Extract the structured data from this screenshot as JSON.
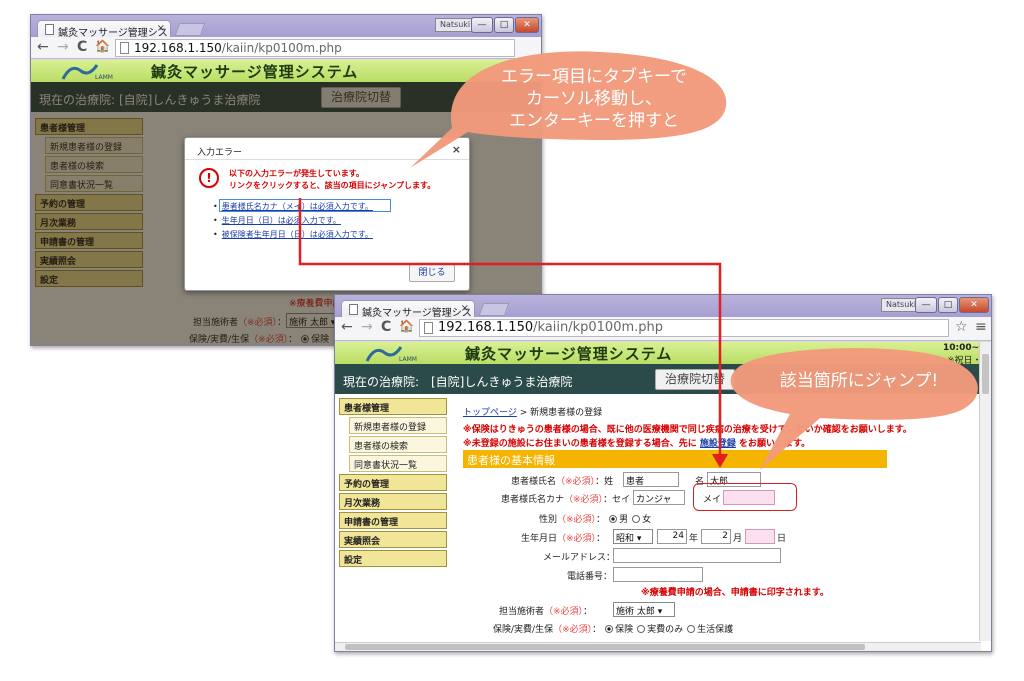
{
  "browser": {
    "tab_title": "鍼灸マッサージ管理シス",
    "tab_close": "×",
    "url_host": "192.168.1.150",
    "url_path": "/kaiin/kp0100m.php",
    "user_badge": "Natsuki",
    "btn_min": "—",
    "btn_max": "□",
    "btn_close": "✕",
    "back": "←",
    "forward": "→",
    "reload": "C",
    "home": "🏠",
    "star": "☆",
    "menu": "≡"
  },
  "app": {
    "logo_text": "LAMM",
    "title": "鍼灸マッサージ管理システム",
    "clinic_label": "現在の治療院:",
    "clinic_value": "[自院]しんきゅうま治療院",
    "switch_button": "治療院切替",
    "clock": "10:00~",
    "clock_sub": "※祝日・"
  },
  "sidebar": {
    "items": [
      {
        "label": "患者様管理",
        "sub": false
      },
      {
        "label": "新規患者様の登録",
        "sub": true
      },
      {
        "label": "患者様の検索",
        "sub": true
      },
      {
        "label": "同意書状況一覧",
        "sub": true
      },
      {
        "label": "予約の管理",
        "sub": false
      },
      {
        "label": "月次業務",
        "sub": false
      },
      {
        "label": "申請書の管理",
        "sub": false
      },
      {
        "label": "実績照会",
        "sub": false
      },
      {
        "label": "設定",
        "sub": false
      }
    ]
  },
  "modal": {
    "title": "入力エラー",
    "close": "×",
    "warn_icon": "!",
    "message1": "以下の入力エラーが発生しています。",
    "message2": "リンクをクリックすると、該当の項目にジャンプします。",
    "bullet": "•",
    "errors": [
      "患者様氏名カナ（メイ）は必須入力です。",
      "生年月日（日）は必須入力です。",
      "被保険者生年月日（日）は必須入力です。"
    ],
    "close_button": "閉じる"
  },
  "form": {
    "breadcrumb_top": "トップページ",
    "breadcrumb_sep": " > ",
    "breadcrumb_current": "新規患者様の登録",
    "notice1": "※保険はりきゅうの患者様の場合、既に他の医療機関で同じ疾病の治療を受けていないか確認をお願いします。",
    "notice2a": "※未登録の施設にお住まいの患者様を登録する場合、先に ",
    "notice2_link": "施設登録",
    "notice2b": " をお願いします。",
    "section_title": "患者様の基本情報",
    "required": "（※必須）",
    "name_label": "患者様氏名",
    "sei": "姓",
    "name_sei": "患者",
    "mei": "名",
    "name_mei": "太郎",
    "kana_label": "患者様氏名カナ",
    "kana_sei_label": "セイ",
    "kana_sei": "カンジャ",
    "kana_mei_label": "メイ",
    "kana_mei": "",
    "gender_label": "性別",
    "gender_male": "男",
    "gender_female": "女",
    "birth_label": "生年月日",
    "era": "昭和 ▾",
    "year": "24",
    "year_unit": "年",
    "month": "2",
    "month_unit": "月",
    "day": "",
    "day_unit": "日",
    "email_label": "メールアドレス",
    "phone_label": "電話番号",
    "phone_note": "※療養費申請の場合、申請書に印字されます。",
    "practitioner_label": "担当施術者",
    "practitioner_value": "施術 太郎 ▾",
    "insurance_label": "保険/実費/生保",
    "ins_opt1": "保険",
    "ins_opt2": "実費のみ",
    "ins_opt3": "生活保護",
    "colon": "：",
    "bg_fragment": "保険はりきゅう… 以下の入力エラー… 生年月日 鍼灸マッサージ管理システム"
  },
  "callouts": {
    "top": [
      "エラー項目にタブキーで",
      "カーソル移動し、",
      "エンターキーを押すと"
    ],
    "bottom": "該当箇所にジャンプ!"
  },
  "colors": {
    "callout": "#f29a7c",
    "arrow": "#e02020",
    "section": "#f5b400",
    "header": "#2b4a4a",
    "banner": "#c8e47a"
  }
}
